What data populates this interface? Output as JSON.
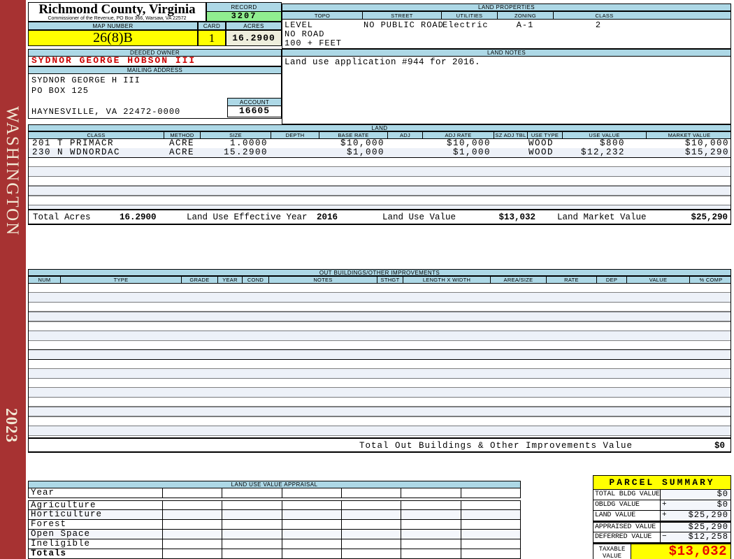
{
  "sidebar": {
    "district": "WASHINGTON",
    "year": "2023"
  },
  "header": {
    "title": "Richmond County, Virginia",
    "subtitle": "Commissioner of the Revenue, PO Box 366, Warsaw, VA 22572",
    "record_label": "RECORD",
    "record_value": "3207",
    "map_number_label": "MAP NUMBER",
    "map_number": "26(8)B",
    "card_label": "CARD",
    "card": "1",
    "acres_label": "ACRES",
    "acres": "16.2900"
  },
  "owner": {
    "deeded_owner_label": "DEEDED OWNER",
    "deeded_owner": "SYDNOR GEORGE HOBSON III",
    "mailing_address_label": "MAILING ADDRESS",
    "mailing_lines": [
      "SYDNOR GEORGE H III",
      "PO BOX 125",
      "",
      "HAYNESVILLE, VA 22472-0000"
    ],
    "account_label": "ACCOUNT",
    "account": "16605"
  },
  "land_properties": {
    "title": "LAND PROPERTIES",
    "columns": [
      "TOPO",
      "STREET",
      "UTILITIES",
      "ZONING",
      "CLASS"
    ],
    "topo_lines": [
      "LEVEL",
      "NO ROAD",
      "100 + FEET"
    ],
    "street": "NO PUBLIC ROAD",
    "utilities": "Electric",
    "zoning": "A-1",
    "class": "2"
  },
  "land_notes": {
    "title": "LAND NOTES",
    "text": "Land use application #944 for 2016."
  },
  "land": {
    "title": "LAND",
    "columns": [
      "CLASS",
      "METHOD",
      "SIZE",
      "DEPTH",
      "BASE RATE",
      "ADJ",
      "ADJ RATE",
      "SZ ADJ TBL",
      "USE TYPE",
      "USE VALUE",
      "MARKET VALUE"
    ],
    "rows": [
      {
        "class": "201 T PRIMACR",
        "method": "ACRE",
        "size": "1.0000",
        "depth": "",
        "base_rate": "$10,000",
        "adj": "",
        "adj_rate": "$10,000",
        "sz_adj_tbl": "",
        "use_type": "WOOD",
        "use_value": "$800",
        "market_value": "$10,000"
      },
      {
        "class": "230 N WDNORDAC",
        "method": "ACRE",
        "size": "15.2900",
        "depth": "",
        "base_rate": "$1,000",
        "adj": "",
        "adj_rate": "$1,000",
        "sz_adj_tbl": "",
        "use_type": "WOOD",
        "use_value": "$12,232",
        "market_value": "$15,290"
      }
    ],
    "totals": {
      "total_acres_label": "Total Acres",
      "total_acres": "16.2900",
      "effective_year_label": "Land Use Effective Year",
      "effective_year": "2016",
      "use_value_label": "Land Use Value",
      "use_value": "$13,032",
      "market_value_label": "Land Market Value",
      "market_value": "$25,290"
    }
  },
  "out_buildings": {
    "title": "OUT BUILDINGS/OTHER IMPROVEMENTS",
    "columns": [
      "NUM",
      "TYPE",
      "GRADE",
      "YEAR",
      "COND",
      "NOTES",
      "STHGT",
      "LENGTH X WIDTH",
      "AREA/SIZE",
      "RATE",
      "DEP",
      "VALUE",
      "% COMP"
    ],
    "total_label": "Total Out Buildings & Other Improvements Value",
    "total_value": "$0"
  },
  "land_use_appraisal": {
    "title": "LAND USE VALUE APPRAISAL",
    "row_labels": [
      "Year",
      "Agriculture",
      "Horticulture",
      "Forest",
      "Open Space",
      "Ineligible",
      "Totals"
    ]
  },
  "parcel_summary": {
    "title": "PARCEL SUMMARY",
    "rows": [
      {
        "label": "TOTAL BLDG VALUE",
        "op": "",
        "value": "$0"
      },
      {
        "label": "OBLDG VALUE",
        "op": "+",
        "value": "$0"
      },
      {
        "label": "LAND VALUE",
        "op": "+",
        "value": "$25,290"
      },
      {
        "label": "APPRAISED VALUE",
        "op": "",
        "value": "$25,290"
      },
      {
        "label": "DEFERRED VALUE",
        "op": "−",
        "value": "$12,258"
      }
    ],
    "taxable_label": [
      "TAXABLE",
      "VALUE"
    ],
    "taxable_value": "$13,032"
  },
  "colors": {
    "header_strip_blue": "#ADD8E6",
    "record_green": "#90EE90",
    "highlight_yellow": "#FFFF00",
    "acres_cream": "#EEEEDC",
    "sidebar_red": "#A73232",
    "owner_red": "#CC0000",
    "taxable_red": "#E60000",
    "row_stripe_blue": "#EDF1F8"
  }
}
